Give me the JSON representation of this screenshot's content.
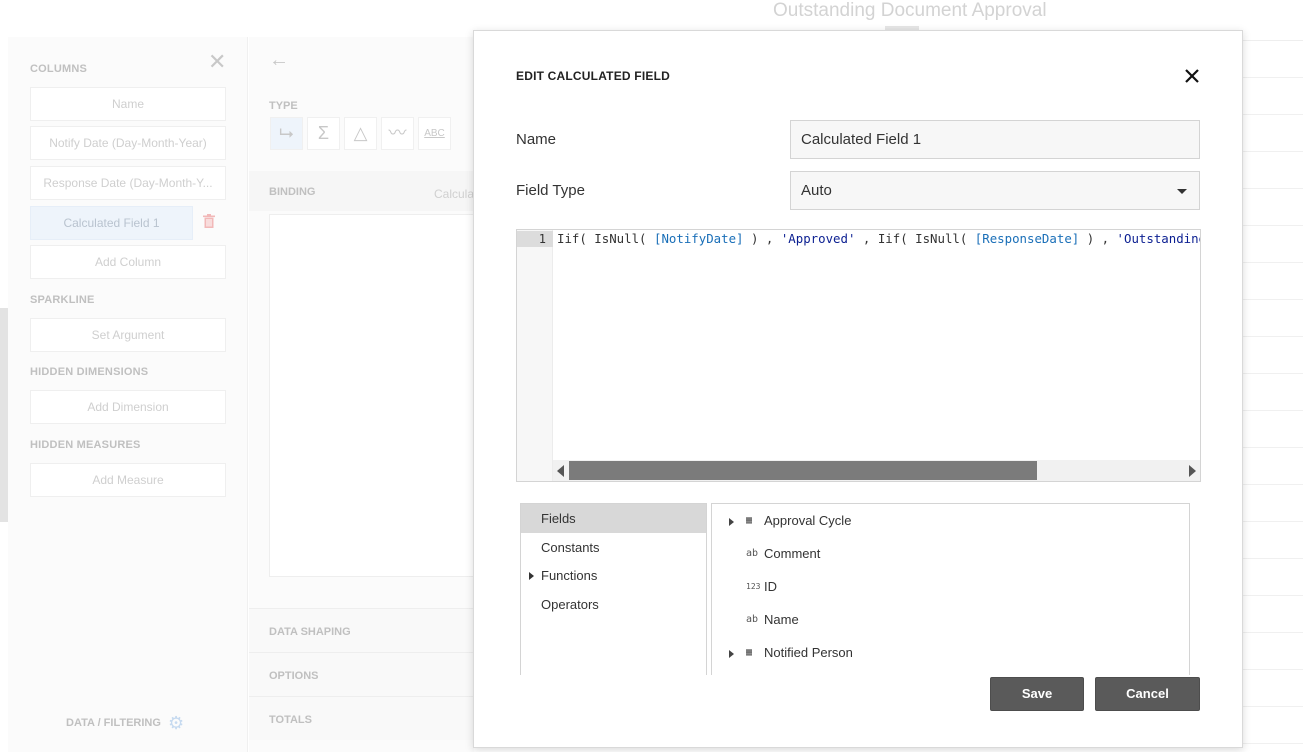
{
  "background": {
    "dashboard_title": "Outstanding Document Approval",
    "left_panel": {
      "sections": {
        "columns": "COLUMNS",
        "sparkline": "SPARKLINE",
        "hidden_dimensions": "HIDDEN DIMENSIONS",
        "hidden_measures": "HIDDEN MEASURES"
      },
      "columns": [
        "Name",
        "Notify Date (Day-Month-Year)",
        "Response Date (Day-Month-Y..."
      ],
      "selected_column": "Calculated Field 1",
      "add_column": "Add Column",
      "set_argument": "Set Argument",
      "add_dimension": "Add Dimension",
      "add_measure": "Add Measure",
      "footer": "DATA / FILTERING"
    },
    "middle_panel": {
      "type_label": "TYPE",
      "binding_label": "BINDING",
      "binding_value": "Calcula",
      "rows": [
        "DATA SHAPING",
        "OPTIONS",
        "TOTALS"
      ],
      "abc_label": "ABC"
    }
  },
  "dialog": {
    "title": "EDIT CALCULATED FIELD",
    "name_label": "Name",
    "name_value": "Calculated Field 1",
    "field_type_label": "Field Type",
    "field_type_value": "Auto",
    "editor": {
      "line_number": "1",
      "code": {
        "p1": "Iif( IsNull( ",
        "f1": "[NotifyDate]",
        "p2": " ) , ",
        "s1": "'Approved'",
        "p3": " , Iif( IsNull( ",
        "f2": "[ResponseDate]",
        "p4": " ) , ",
        "s2": "'Outstanding A"
      }
    },
    "categories": [
      {
        "label": "Fields",
        "selected": true,
        "expandable": false
      },
      {
        "label": "Constants",
        "selected": false,
        "expandable": false
      },
      {
        "label": "Functions",
        "selected": false,
        "expandable": true
      },
      {
        "label": "Operators",
        "selected": false,
        "expandable": false
      }
    ],
    "fields": [
      {
        "label": "Approval Cycle",
        "icon": "table-icon",
        "glyph": "▦",
        "expandable": true
      },
      {
        "label": "Comment",
        "icon": "string-type-icon",
        "glyph": "ab",
        "expandable": false
      },
      {
        "label": "ID",
        "icon": "number-type-icon",
        "glyph": "123",
        "expandable": false
      },
      {
        "label": "Name",
        "icon": "string-type-icon",
        "glyph": "ab",
        "expandable": false
      },
      {
        "label": "Notified Person",
        "icon": "table-icon",
        "glyph": "▦",
        "expandable": true
      }
    ],
    "save_label": "Save",
    "cancel_label": "Cancel"
  }
}
